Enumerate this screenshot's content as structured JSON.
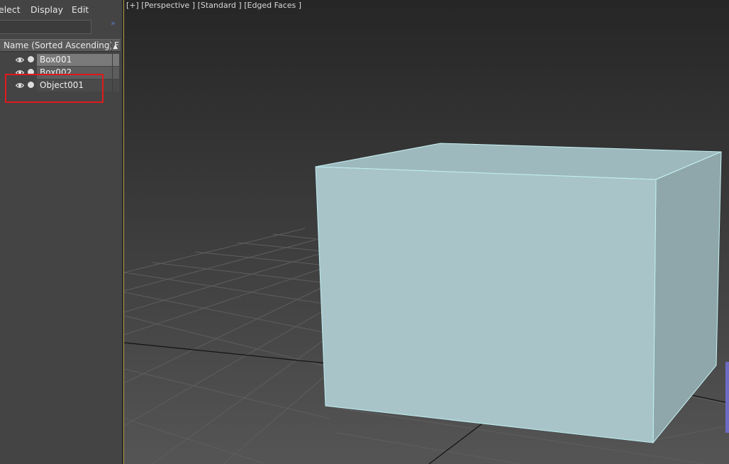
{
  "menu": {
    "select": "elect",
    "display": "Display",
    "edit": "Edit"
  },
  "search": {
    "placeholder": ""
  },
  "expand_icon": "double-chevron-right-icon",
  "columns": {
    "name": "Name (Sorted Ascending)",
    "sort_indicator": "▲",
    "next": "F"
  },
  "rows": [
    {
      "label": "Box001",
      "state": "selected"
    },
    {
      "label": "Box002",
      "state": "partially-hidden"
    },
    {
      "label": "Object001",
      "state": "highlighted"
    }
  ],
  "highlight_color": "#e0191c",
  "viewport": {
    "label": "[+] [Perspective ] [Standard ] [Edged Faces ]",
    "box_color": "#a8c4c9",
    "edge_color": "#bfeef2",
    "grid_color": "#5e5e5e"
  }
}
